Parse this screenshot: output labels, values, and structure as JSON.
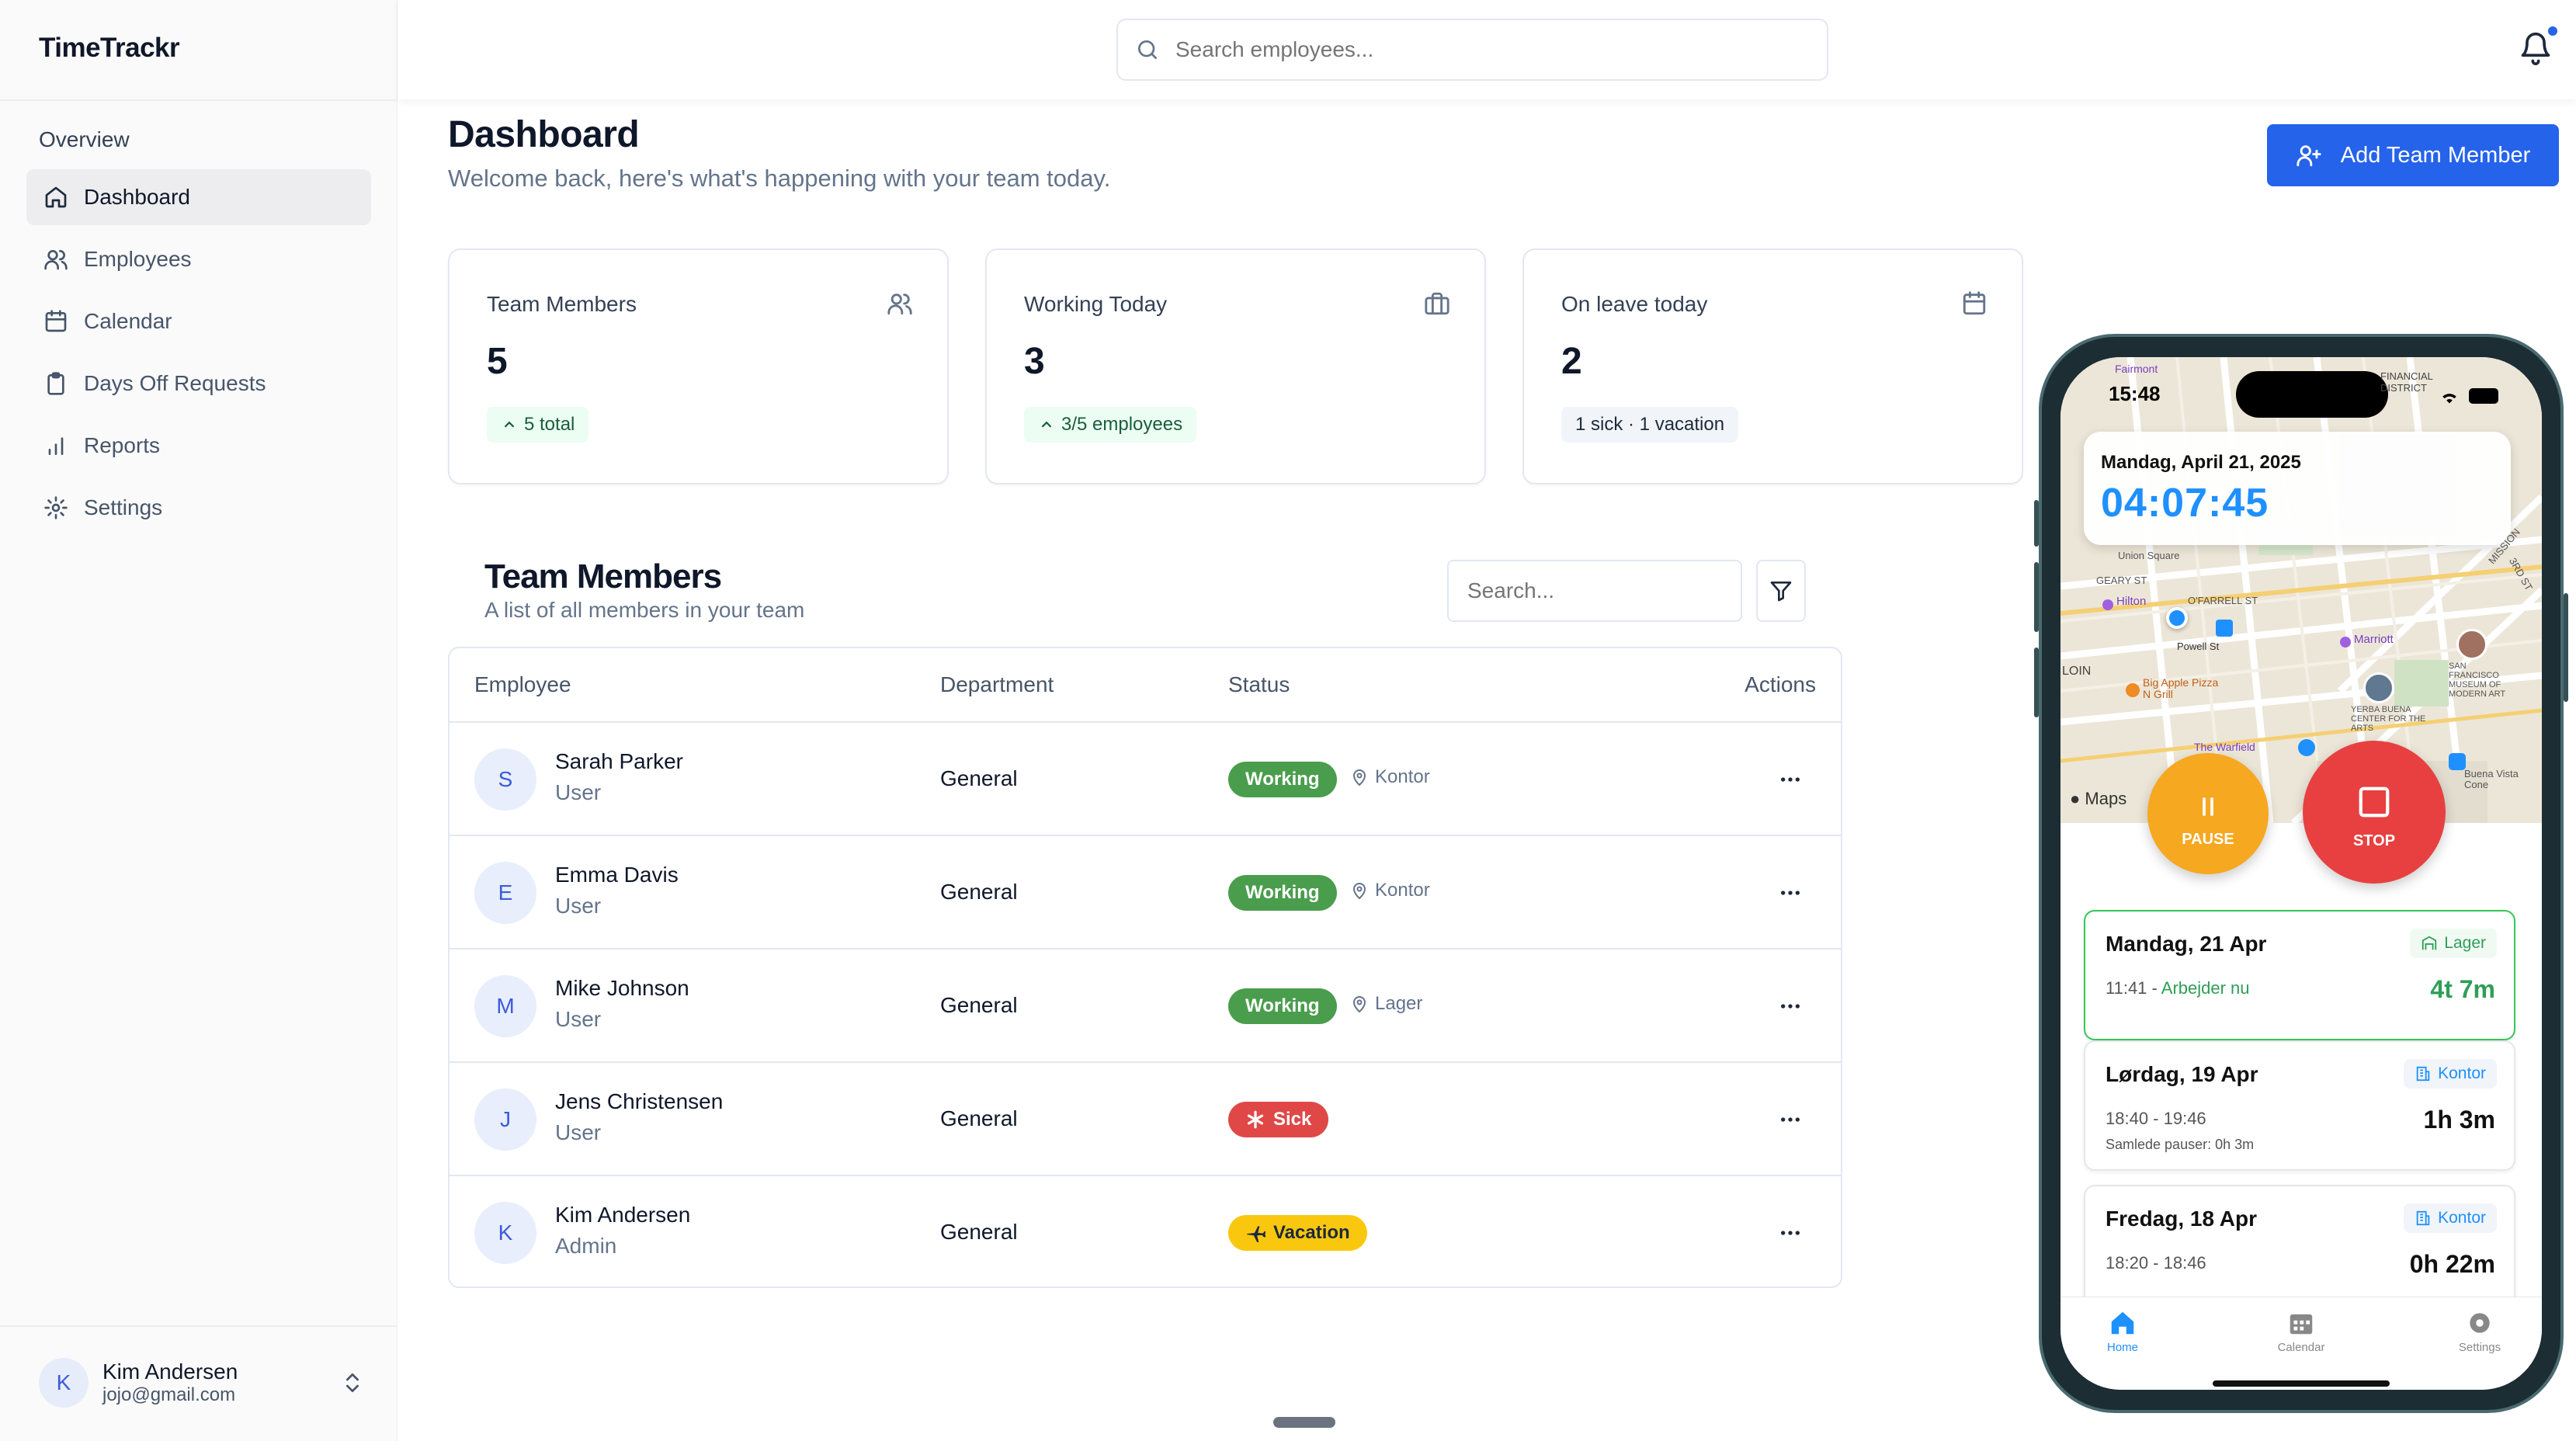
{
  "app": {
    "name": "TimeTrackr"
  },
  "sidebar": {
    "group_label": "Overview",
    "items": [
      {
        "label": "Dashboard",
        "icon": "home-icon",
        "active": true
      },
      {
        "label": "Employees",
        "icon": "users-icon"
      },
      {
        "label": "Calendar",
        "icon": "calendar-icon"
      },
      {
        "label": "Days Off Requests",
        "icon": "clipboard-icon"
      },
      {
        "label": "Reports",
        "icon": "bar-chart-icon"
      },
      {
        "label": "Settings",
        "icon": "gear-icon"
      }
    ],
    "user": {
      "initial": "K",
      "name": "Kim Andersen",
      "email": "jojo@gmail.com"
    }
  },
  "topbar": {
    "search_placeholder": "Search employees...",
    "has_notification": true
  },
  "header": {
    "title": "Dashboard",
    "subtitle": "Welcome back, here's what's happening with your team today.",
    "add_button": "Add Team Member"
  },
  "stats": [
    {
      "label": "Team Members",
      "value": "5",
      "badge": "5 total",
      "icon": "users-icon"
    },
    {
      "label": "Working Today",
      "value": "3",
      "badge": "3/5 employees",
      "icon": "briefcase-icon"
    },
    {
      "label": "On leave today",
      "value": "2",
      "badge": "1 sick · 1 vacation",
      "icon": "calendar-icon"
    }
  ],
  "team": {
    "title": "Team Members",
    "subtitle": "A list of all members in your team",
    "search_placeholder": "Search...",
    "columns": {
      "employee": "Employee",
      "department": "Department",
      "status": "Status",
      "actions": "Actions"
    },
    "rows": [
      {
        "initial": "S",
        "name": "Sarah Parker",
        "role": "User",
        "department": "General",
        "status": "Working",
        "location": "Kontor"
      },
      {
        "initial": "E",
        "name": "Emma Davis",
        "role": "User",
        "department": "General",
        "status": "Working",
        "location": "Kontor"
      },
      {
        "initial": "M",
        "name": "Mike Johnson",
        "role": "User",
        "department": "General",
        "status": "Working",
        "location": "Lager"
      },
      {
        "initial": "J",
        "name": "Jens Christensen",
        "role": "User",
        "department": "General",
        "status": "Sick",
        "location": ""
      },
      {
        "initial": "K",
        "name": "Kim Andersen",
        "role": "Admin",
        "department": "General",
        "status": "Vacation",
        "location": ""
      }
    ]
  },
  "phone": {
    "clock": "15:48",
    "date": "Mandag, April 21, 2025",
    "timer": "04:07:45",
    "maps_label": "Maps",
    "map_labels": [
      "Fairmont",
      "FINANCIAL DISTRICT",
      "GEARY ST",
      "O'FARRELL ST",
      "Hilton",
      "Powell St",
      "Marriott",
      "Big Apple Pizza N Grill",
      "SAN FRANCISCO MUSEUM OF MODERN ART",
      "YERBA BUENA CENTER FOR THE ARTS",
      "The Warfield",
      "Buena Vista Cone",
      "3RD ST",
      "MISSION",
      "LOIN",
      "Union Square"
    ],
    "pause_label": "PAUSE",
    "stop_label": "STOP",
    "entries": [
      {
        "date": "Mandag, 21 Apr",
        "tag": "Lager",
        "time": "11:41 - ",
        "now": "Arbejder nu",
        "duration": "4t 7m",
        "current": true,
        "extra": ""
      },
      {
        "date": "Lørdag, 19 Apr",
        "tag": "Kontor",
        "time": "18:40 - 19:46",
        "now": "",
        "duration": "1h 3m",
        "current": false,
        "extra": "Samlede pauser: 0h 3m"
      },
      {
        "date": "Fredag, 18 Apr",
        "tag": "Kontor",
        "time": "18:20 - 18:46",
        "now": "",
        "duration": "0h 22m",
        "current": false,
        "extra": ""
      }
    ],
    "tabs": [
      {
        "label": "Home",
        "icon": "home-icon",
        "active": true
      },
      {
        "label": "Calendar",
        "icon": "calendar-icon"
      },
      {
        "label": "Settings",
        "icon": "gear-icon"
      }
    ]
  },
  "colors": {
    "accent": "#2563eb",
    "working": "#4a9d4c",
    "sick": "#e04848",
    "vacation": "#f9c80e",
    "pause": "#f6a821",
    "stop": "#e84040",
    "timer": "#1e90ff"
  }
}
